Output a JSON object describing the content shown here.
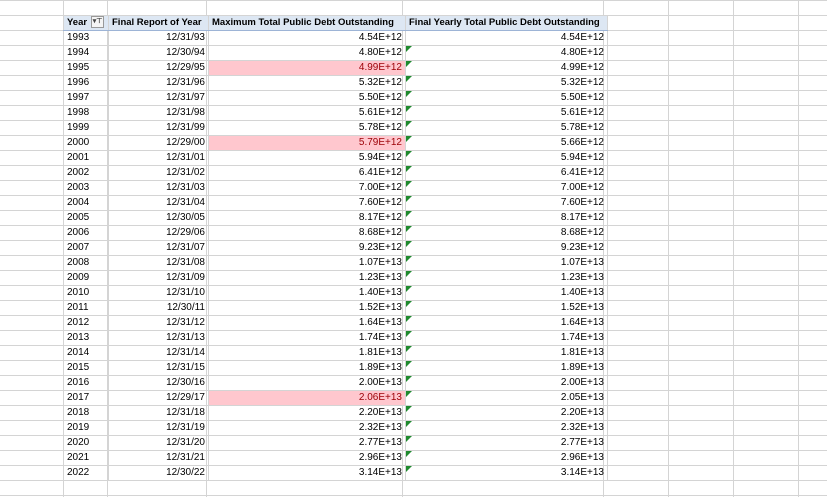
{
  "headers": {
    "year": "Year",
    "final_report": "Final Report of Year",
    "max_debt": "Maximum Total Public Debt Outstanding",
    "final_debt": "Final Yearly Total Public Debt Outstanding"
  },
  "colors": {
    "highlight_fill": "#ffc7ce",
    "highlight_text": "#9c0006",
    "header_fill": "#dde7f3"
  },
  "rows": [
    {
      "year": "1993",
      "date": "12/31/93",
      "max": "4.54E+12",
      "final": "4.54E+12",
      "hl": false,
      "tri": false
    },
    {
      "year": "1994",
      "date": "12/30/94",
      "max": "4.80E+12",
      "final": "4.80E+12",
      "hl": false,
      "tri": true
    },
    {
      "year": "1995",
      "date": "12/29/95",
      "max": "4.99E+12",
      "final": "4.99E+12",
      "hl": true,
      "tri": true
    },
    {
      "year": "1996",
      "date": "12/31/96",
      "max": "5.32E+12",
      "final": "5.32E+12",
      "hl": false,
      "tri": true
    },
    {
      "year": "1997",
      "date": "12/31/97",
      "max": "5.50E+12",
      "final": "5.50E+12",
      "hl": false,
      "tri": true
    },
    {
      "year": "1998",
      "date": "12/31/98",
      "max": "5.61E+12",
      "final": "5.61E+12",
      "hl": false,
      "tri": true
    },
    {
      "year": "1999",
      "date": "12/31/99",
      "max": "5.78E+12",
      "final": "5.78E+12",
      "hl": false,
      "tri": true
    },
    {
      "year": "2000",
      "date": "12/29/00",
      "max": "5.79E+12",
      "final": "5.66E+12",
      "hl": true,
      "tri": true
    },
    {
      "year": "2001",
      "date": "12/31/01",
      "max": "5.94E+12",
      "final": "5.94E+12",
      "hl": false,
      "tri": true
    },
    {
      "year": "2002",
      "date": "12/31/02",
      "max": "6.41E+12",
      "final": "6.41E+12",
      "hl": false,
      "tri": true
    },
    {
      "year": "2003",
      "date": "12/31/03",
      "max": "7.00E+12",
      "final": "7.00E+12",
      "hl": false,
      "tri": true
    },
    {
      "year": "2004",
      "date": "12/31/04",
      "max": "7.60E+12",
      "final": "7.60E+12",
      "hl": false,
      "tri": true
    },
    {
      "year": "2005",
      "date": "12/30/05",
      "max": "8.17E+12",
      "final": "8.17E+12",
      "hl": false,
      "tri": true
    },
    {
      "year": "2006",
      "date": "12/29/06",
      "max": "8.68E+12",
      "final": "8.68E+12",
      "hl": false,
      "tri": true
    },
    {
      "year": "2007",
      "date": "12/31/07",
      "max": "9.23E+12",
      "final": "9.23E+12",
      "hl": false,
      "tri": true
    },
    {
      "year": "2008",
      "date": "12/31/08",
      "max": "1.07E+13",
      "final": "1.07E+13",
      "hl": false,
      "tri": true
    },
    {
      "year": "2009",
      "date": "12/31/09",
      "max": "1.23E+13",
      "final": "1.23E+13",
      "hl": false,
      "tri": true
    },
    {
      "year": "2010",
      "date": "12/31/10",
      "max": "1.40E+13",
      "final": "1.40E+13",
      "hl": false,
      "tri": true
    },
    {
      "year": "2011",
      "date": "12/30/11",
      "max": "1.52E+13",
      "final": "1.52E+13",
      "hl": false,
      "tri": true
    },
    {
      "year": "2012",
      "date": "12/31/12",
      "max": "1.64E+13",
      "final": "1.64E+13",
      "hl": false,
      "tri": true
    },
    {
      "year": "2013",
      "date": "12/31/13",
      "max": "1.74E+13",
      "final": "1.74E+13",
      "hl": false,
      "tri": true
    },
    {
      "year": "2014",
      "date": "12/31/14",
      "max": "1.81E+13",
      "final": "1.81E+13",
      "hl": false,
      "tri": true
    },
    {
      "year": "2015",
      "date": "12/31/15",
      "max": "1.89E+13",
      "final": "1.89E+13",
      "hl": false,
      "tri": true
    },
    {
      "year": "2016",
      "date": "12/30/16",
      "max": "2.00E+13",
      "final": "2.00E+13",
      "hl": false,
      "tri": true
    },
    {
      "year": "2017",
      "date": "12/29/17",
      "max": "2.06E+13",
      "final": "2.05E+13",
      "hl": true,
      "tri": true
    },
    {
      "year": "2018",
      "date": "12/31/18",
      "max": "2.20E+13",
      "final": "2.20E+13",
      "hl": false,
      "tri": true
    },
    {
      "year": "2019",
      "date": "12/31/19",
      "max": "2.32E+13",
      "final": "2.32E+13",
      "hl": false,
      "tri": true
    },
    {
      "year": "2020",
      "date": "12/31/20",
      "max": "2.77E+13",
      "final": "2.77E+13",
      "hl": false,
      "tri": true
    },
    {
      "year": "2021",
      "date": "12/31/21",
      "max": "2.96E+13",
      "final": "2.96E+13",
      "hl": false,
      "tri": true
    },
    {
      "year": "2022",
      "date": "12/30/22",
      "max": "3.14E+13",
      "final": "3.14E+13",
      "hl": false,
      "tri": true
    }
  ]
}
